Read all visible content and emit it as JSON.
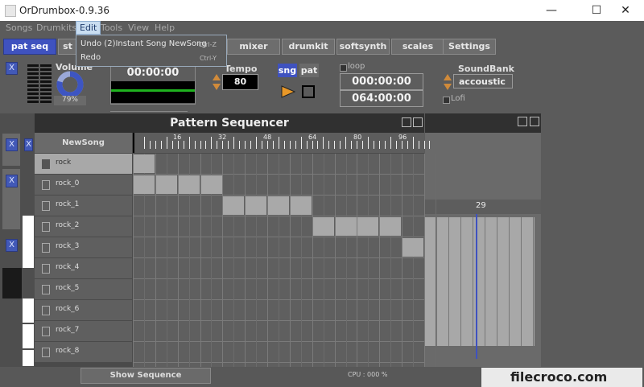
{
  "window": {
    "title": "OrDrumbox-0.9.36",
    "minimize": "—",
    "maximize": "☐",
    "close": "✕"
  },
  "menus": [
    "Songs",
    "Drumkits",
    "Edit",
    "Tools",
    "View",
    "Help"
  ],
  "edit_menu": {
    "items": [
      {
        "label": "Undo  (2)Instant Song NewSong",
        "shortcut": "Ctrl-Z"
      },
      {
        "label": "Redo",
        "shortcut": "Ctrl-Y"
      }
    ]
  },
  "tabs": [
    "pat seq",
    "st",
    "mixer",
    "drumkit",
    "softsynth",
    "scales",
    "Settings"
  ],
  "top": {
    "close_x": "X",
    "volume_label": "Volume",
    "volume_value": "79%",
    "volume_level": 0.79,
    "time": "00:00:00",
    "tempo_label": "Tempo",
    "tempo_value": "80",
    "sng_label": "sng",
    "pat_label": "pat",
    "loop_label": "loop",
    "loop_start": "000:00:00",
    "loop_end": "064:00:00",
    "soundbank_label": "SoundBank",
    "soundbank_value": "accoustic",
    "lofi_label": "Lofi"
  },
  "sequencer": {
    "title": "Pattern Sequencer",
    "song_name": "NewSong",
    "ruler_ticks": [
      "16",
      "32",
      "48",
      "64",
      "80",
      "96"
    ],
    "tracks": [
      {
        "name": "rock",
        "selected": true
      },
      {
        "name": "rock_0",
        "selected": false
      },
      {
        "name": "rock_1",
        "selected": false
      },
      {
        "name": "rock_2",
        "selected": false
      },
      {
        "name": "rock_3",
        "selected": false
      },
      {
        "name": "rock_4",
        "selected": false
      },
      {
        "name": "rock_5",
        "selected": false
      },
      {
        "name": "rock_6",
        "selected": false
      },
      {
        "name": "rock_7",
        "selected": false
      },
      {
        "name": "rock_8",
        "selected": false
      }
    ],
    "filled_blocks": [
      {
        "track": 0,
        "start": 0,
        "length": 1
      },
      {
        "track": 1,
        "start": 0,
        "length": 4
      },
      {
        "track": 2,
        "start": 4,
        "length": 4
      },
      {
        "track": 3,
        "start": 8,
        "length": 4
      },
      {
        "track": 4,
        "start": 12,
        "length": 1
      }
    ],
    "columns": 13
  },
  "side_panel": {
    "ruler_label": "29"
  },
  "status": {
    "show_sequence": "Show Sequence",
    "cpu": "CPU : 000 %",
    "watermark": "filecroco.com"
  },
  "colors": {
    "accent": "#3f52bf",
    "background": "#5b5b5b",
    "cell_filled": "#a9a9a9"
  }
}
